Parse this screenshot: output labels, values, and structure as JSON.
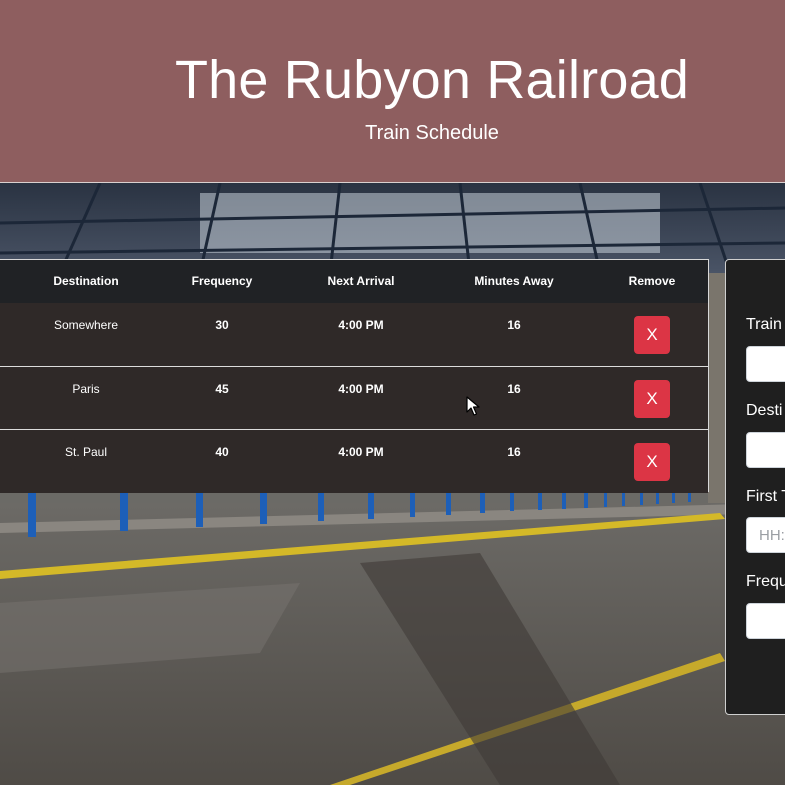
{
  "header": {
    "title": "The Rubyon Railroad",
    "subtitle": "Train Schedule"
  },
  "table": {
    "columns": [
      "Destination",
      "Frequency",
      "Next Arrival",
      "Minutes Away",
      "Remove"
    ],
    "rows": [
      {
        "destination": "Somewhere",
        "frequency": "30",
        "next_arrival": "4:00 PM",
        "minutes_away": "16",
        "remove_label": "X"
      },
      {
        "destination": "Paris",
        "frequency": "45",
        "next_arrival": "4:00 PM",
        "minutes_away": "16",
        "remove_label": "X"
      },
      {
        "destination": "St. Paul",
        "frequency": "40",
        "next_arrival": "4:00 PM",
        "minutes_away": "16",
        "remove_label": "X"
      }
    ]
  },
  "form": {
    "train_label": "Train",
    "destination_label": "Desti",
    "first_time_label": "First T",
    "first_time_placeholder": "HH:",
    "frequency_label": "Frequ"
  },
  "colors": {
    "header_bg": "#8e5e5f",
    "remove_button": "#dc3545",
    "table_head_bg": "#202225",
    "table_row_bg": "#2f2928",
    "form_bg": "#1f1f1f"
  },
  "icons": [
    "mouse-cursor-icon"
  ]
}
